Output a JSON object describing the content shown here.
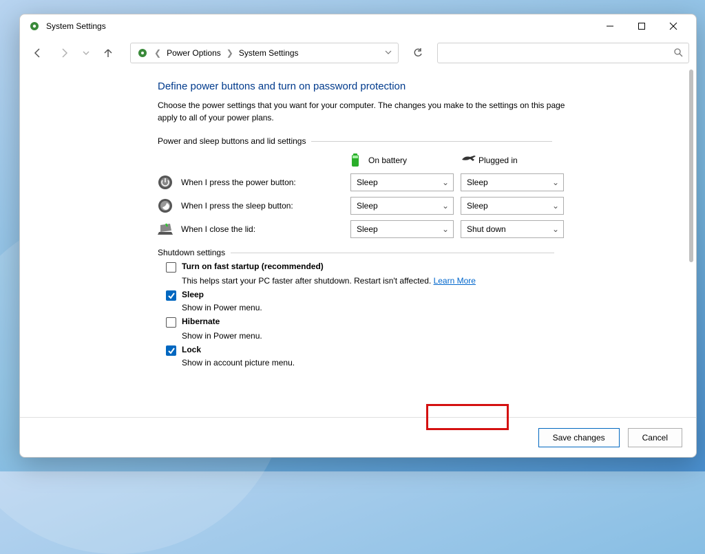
{
  "window": {
    "title": "System Settings"
  },
  "breadcrumb": {
    "item1": "Power Options",
    "item2": "System Settings"
  },
  "page": {
    "title": "Define power buttons and turn on password protection",
    "description": "Choose the power settings that you want for your computer. The changes you make to the settings on this page apply to all of your power plans."
  },
  "section1": {
    "label": "Power and sleep buttons and lid settings",
    "col_battery": "On battery",
    "col_plugged": "Plugged in",
    "rows": {
      "power": {
        "label": "When I press the power button:",
        "battery": "Sleep",
        "plugged": "Sleep"
      },
      "sleep": {
        "label": "When I press the sleep button:",
        "battery": "Sleep",
        "plugged": "Sleep"
      },
      "lid": {
        "label": "When I close the lid:",
        "battery": "Sleep",
        "plugged": "Shut down"
      }
    }
  },
  "section2": {
    "label": "Shutdown settings",
    "fast": {
      "label": "Turn on fast startup (recommended)",
      "desc": "This helps start your PC faster after shutdown. Restart isn't affected.",
      "learn": "Learn More",
      "checked": false
    },
    "sleep": {
      "label": "Sleep",
      "desc": "Show in Power menu.",
      "checked": true
    },
    "hiber": {
      "label": "Hibernate",
      "desc": "Show in Power menu.",
      "checked": false
    },
    "lock": {
      "label": "Lock",
      "desc": "Show in account picture menu.",
      "checked": true
    }
  },
  "buttons": {
    "save": "Save changes",
    "cancel": "Cancel"
  }
}
